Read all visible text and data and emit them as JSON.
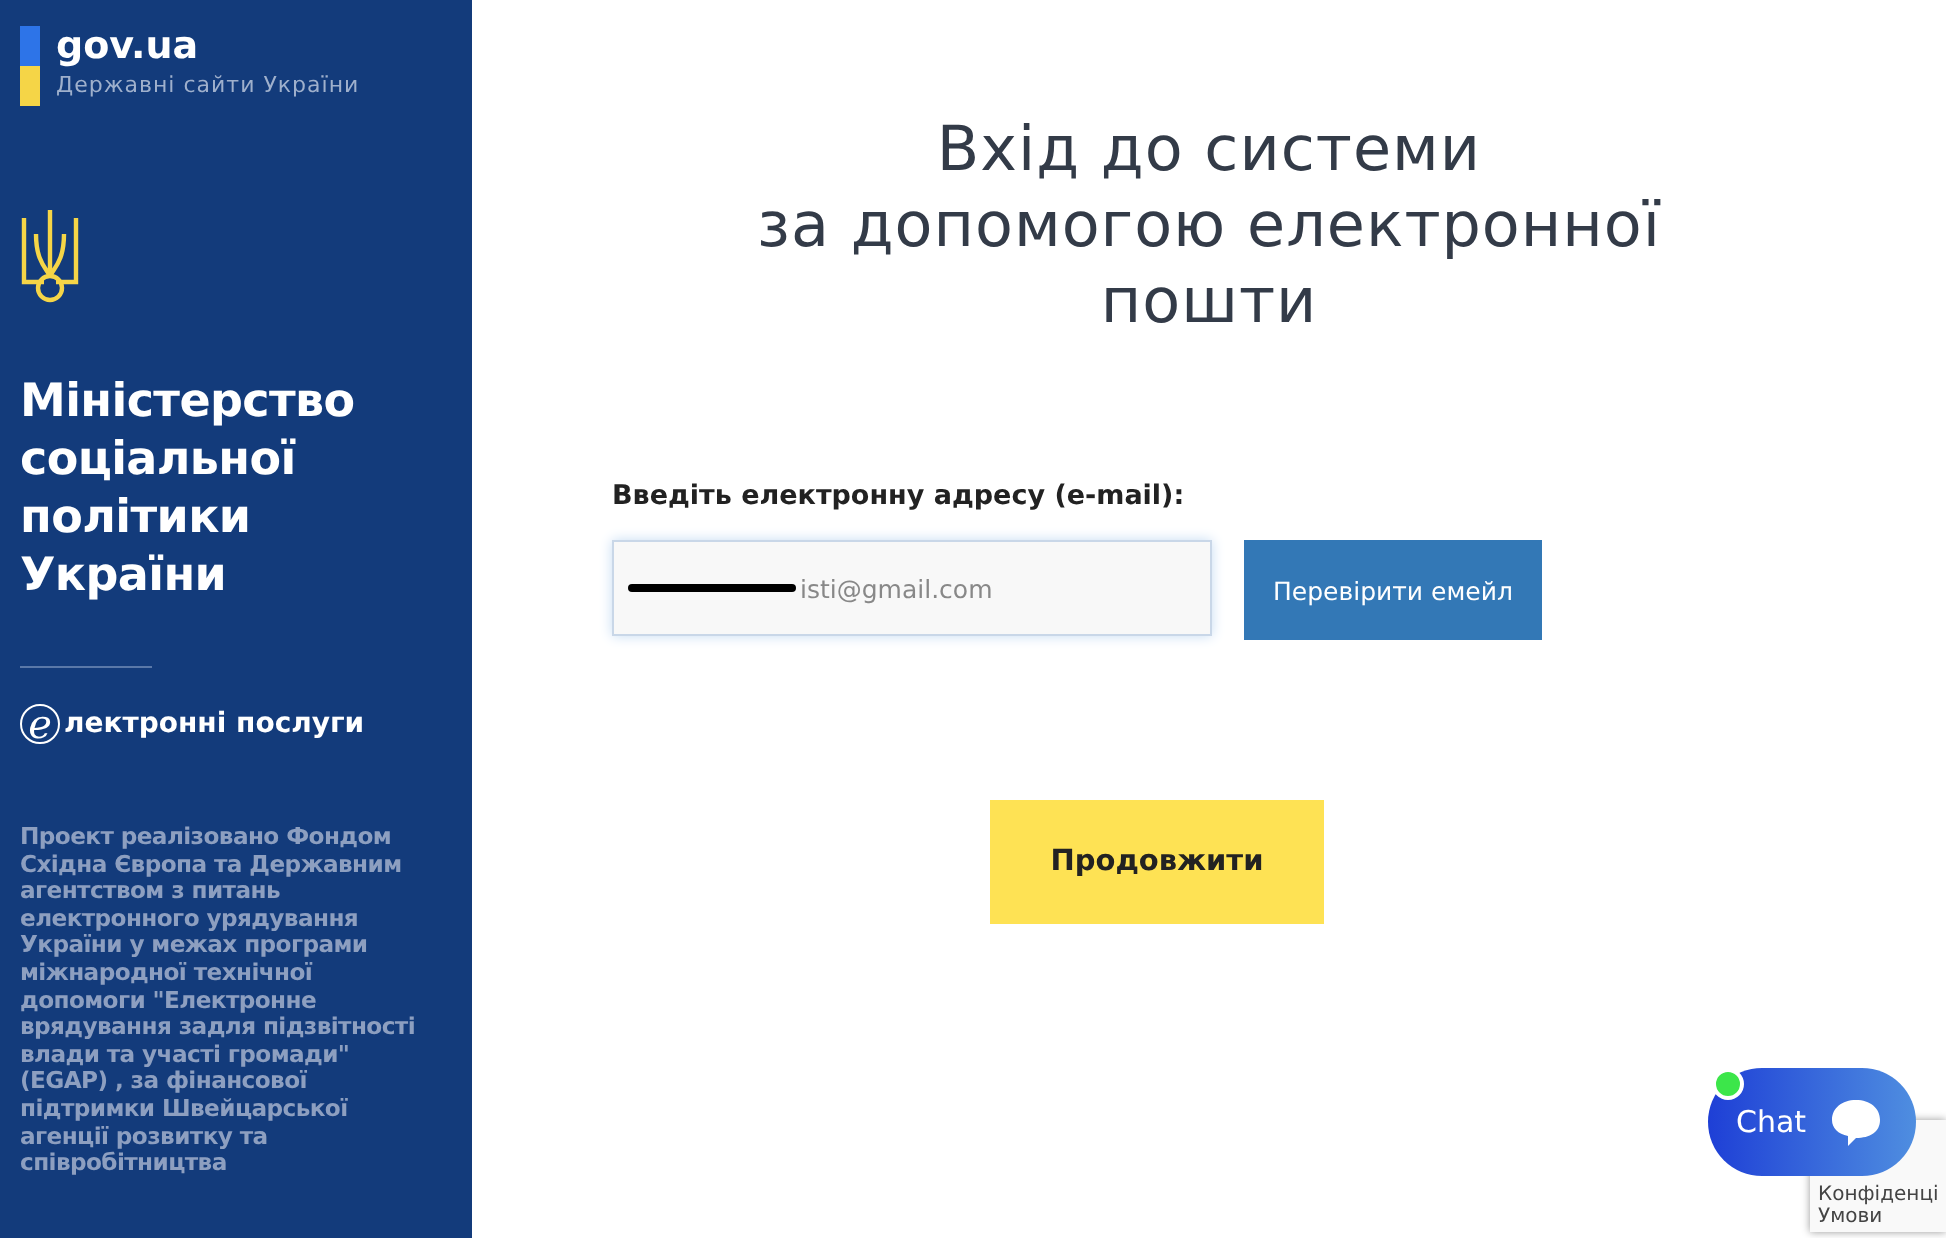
{
  "sidebar": {
    "brand": {
      "name": "gov.ua",
      "tagline": "Державні сайти України"
    },
    "ministry": "Міністерство соціальної політики України",
    "service": {
      "letter": "e",
      "text": "лектронні послуги"
    },
    "credits": "Проект реалізовано **Фондом Східна Європа** та **Державним агентством з питань електронного урядування України** у межах програми міжнародної технічної допомоги **\"Електронне врядування задля підзвітності влади та участі громади\"** (EGAP) , за фінансової підтримки **Швейцарської агенції розвитку та співробітництва**"
  },
  "main": {
    "title_lines": [
      "Вхід до системи",
      "за допомогою електронної",
      "пошти"
    ],
    "email_label": "Введіть електронну адресу (e-mail):",
    "email_value": "isti@gmail.com",
    "check_button": "Перевірити емейл",
    "continue_button": "Продовжити"
  },
  "chat": {
    "label": "Chat",
    "online": true
  },
  "recaptcha": {
    "lines": [
      "Конфіденці",
      "Умови"
    ]
  }
}
